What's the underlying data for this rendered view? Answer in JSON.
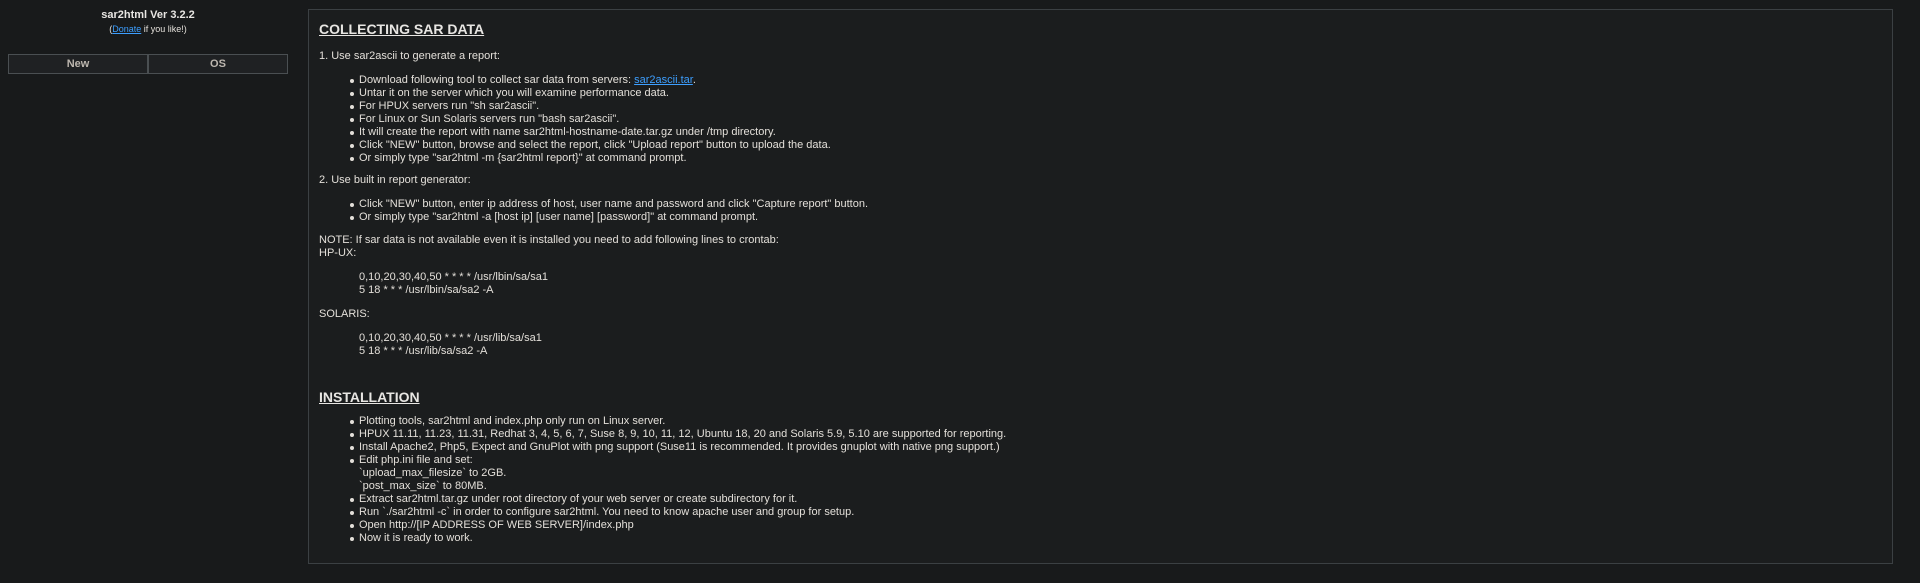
{
  "sidebar": {
    "title": "sar2html Ver 3.2.2",
    "donate_prefix": "(",
    "donate_link": "Donate",
    "donate_suffix": " if you like!)",
    "buttons": {
      "new": "New",
      "os": "OS"
    }
  },
  "collecting": {
    "heading": "COLLECTING SAR DATA",
    "step1": "1. Use sar2ascii to generate a report:",
    "step1_bullets": {
      "b1_prefix": "Download following tool to collect sar data from servers: ",
      "b1_link": "sar2ascii.tar",
      "b1_suffix": ".",
      "b2": "Untar it on the server which you will examine performance data.",
      "b3": "For HPUX servers run \"sh sar2ascii\".",
      "b4": "For Linux or Sun Solaris servers run \"bash sar2ascii\".",
      "b5": "It will create the report with name sar2html-hostname-date.tar.gz under /tmp directory.",
      "b6": "Click \"NEW\" button, browse and select the report, click \"Upload report\" button to upload the data.",
      "b7": "Or simply type \"sar2html -m {sar2html report}\" at command prompt."
    },
    "step2": "2. Use built in report generator:",
    "step2_bullets": {
      "b1": "Click \"NEW\" button, enter ip address of host, user name and password and click \"Capture report\" button.",
      "b2": "Or simply type \"sar2html -a [host ip] [user name] [password]\" at command prompt."
    },
    "note": "NOTE: If sar data is not available even it is installed you need to add following lines to crontab:",
    "hpux_label": "HP-UX:",
    "hpux_lines": {
      "l1": "0,10,20,30,40,50 * * * * /usr/lbin/sa/sa1",
      "l2": "5 18 * * * /usr/lbin/sa/sa2 -A"
    },
    "solaris_label": "SOLARIS:",
    "solaris_lines": {
      "l1": "0,10,20,30,40,50 * * * * /usr/lib/sa/sa1",
      "l2": "5 18 * * * /usr/lib/sa/sa2 -A"
    }
  },
  "installation": {
    "heading": "INSTALLATION",
    "bullets": {
      "b1": "Plotting tools, sar2html and index.php only run on Linux server.",
      "b2": "HPUX 11.11, 11.23, 11.31, Redhat 3, 4, 5, 6, 7, Suse 8, 9, 10, 11, 12, Ubuntu 18, 20 and Solaris 5.9, 5.10 are supported for reporting.",
      "b3": "Install Apache2, Php5, Expect and GnuPlot with png support (Suse11 is recommended. It provides gnuplot with native png support.)",
      "b4": "Edit php.ini file and set:",
      "b4_sub1": "`upload_max_filesize` to 2GB.",
      "b4_sub2": "`post_max_size` to 80MB.",
      "b5": "Extract sar2html.tar.gz under root directory of your web server or create subdirectory for it.",
      "b6": "Run `./sar2html -c` in order to configure sar2html. You need to know apache user and group for setup.",
      "b7": "Open http://[IP ADDRESS OF WEB SERVER]/index.php",
      "b8": "Now it is ready to work."
    }
  }
}
